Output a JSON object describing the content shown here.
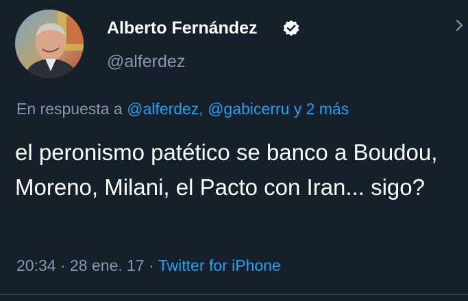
{
  "author": {
    "display_name": "Alberto Fernández",
    "handle": "@alferdez",
    "verified": true,
    "avatar_icon": "profile-photo"
  },
  "reply": {
    "prefix": "En respuesta a",
    "mention_1": "@alferdez,",
    "mention_2": "@gabicerru",
    "suffix": "y 2 más"
  },
  "tweet": {
    "text": "el peronismo patético se banco a Boudou, Moreno, Milani, el Pacto con Iran... sigo?"
  },
  "meta": {
    "time": "20:34",
    "separator_1": "·",
    "date": "28 ene. 17",
    "separator_2": "·",
    "source": "Twitter for iPhone"
  },
  "colors": {
    "background": "#15202b",
    "text": "#ffffff",
    "muted": "#8899a6",
    "link": "#1da1f2"
  }
}
